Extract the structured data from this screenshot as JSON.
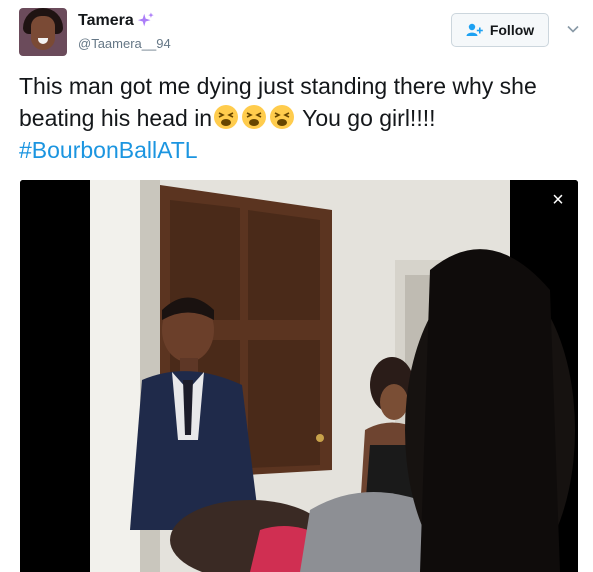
{
  "user": {
    "display_name": "Tamera",
    "handle": "@Taamera__94"
  },
  "follow_button": {
    "label": "Follow"
  },
  "tweet": {
    "text_before_emoji": "This man got me dying just standing there why she beating his head in",
    "emoji": [
      "weary-face",
      "weary-face",
      "weary-face"
    ],
    "text_after_emoji": " You go girl!!!!",
    "hashtag": "#BourbonBallATL"
  },
  "video": {
    "close_label": "×"
  },
  "colors": {
    "link": "#1b95e0",
    "text": "#14171a",
    "secondary": "#657786",
    "sparkle": "#ab7df8"
  }
}
